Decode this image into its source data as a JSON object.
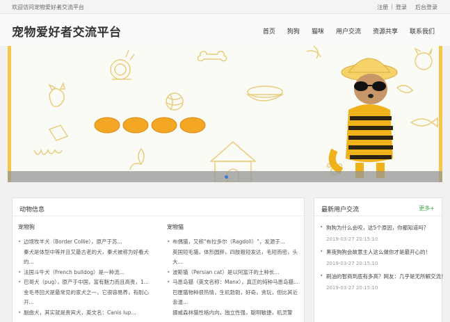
{
  "topbar": {
    "welcome": "欢迎访问宠物爱好者交流平台",
    "register": "注册",
    "separator": "|",
    "login": "登录",
    "admin_login": "后台登录"
  },
  "header": {
    "logo": "宠物爱好者交流平台",
    "nav": [
      "首页",
      "狗狗",
      "猫咪",
      "用户交流",
      "资源共享",
      "联系我们"
    ]
  },
  "banner": {
    "slide_count": 1,
    "active_slide": 1,
    "accent_color": "#f4c74a",
    "indicator_color": "#3a7bd5"
  },
  "animals": {
    "title": "动物信息",
    "dogs": {
      "title": "宠物狗",
      "items": [
        {
          "text": "边境牧羊犬（Border Collie），原产于苏...",
          "bullet": true
        },
        {
          "text": "秦犬是体型中等并且又最古老的犬，秦犬被称为好看犬的...",
          "bullet": false
        },
        {
          "text": "法国斗牛犬（French bulldog）是一种流...",
          "bullet": true
        },
        {
          "text": "巴哥犬（pug），原产于中国，富有魅力而且高贵，1...",
          "bullet": true
        },
        {
          "text": "金毛寻回犬是最常见的家犬之一，它很容易养，有耐心开...",
          "bullet": false
        },
        {
          "text": "副曲犬，其实就是贵宾犬，英文名：Canis lup...",
          "bullet": true
        }
      ]
    },
    "cats": {
      "title": "宠物猫",
      "items": [
        {
          "text": "布偶猫，又称\"布拉多尔（Ragdoll）\"，发源于...",
          "bullet": true
        },
        {
          "text": "英国短毛猫，体形圆胖，四肢粗短发达，毛短而密，头大...",
          "bullet": false
        },
        {
          "text": "波斯猫（Persian cat）是以阿富汗的土种长...",
          "bullet": true
        },
        {
          "text": "马恩岛猫（英文名称：Manx），真正的纯种马恩岛猫...",
          "bullet": true
        },
        {
          "text": "巴厘猫物种很热情，生机勃勃，好奇，贪玩，但比其近亲温...",
          "bullet": false
        },
        {
          "text": "挪威森林猫性格内向，独立性强，聪明敏捷，机灵警",
          "bullet": false
        }
      ]
    }
  },
  "recent": {
    "title": "最新用户交流",
    "more": "更多+",
    "posts": [
      {
        "title": "狗狗为什么会咬，这5个原因，你都知道吗？",
        "date": "2019-03-27 20:15:10"
      },
      {
        "title": "黑夜狗狗会故意主人这么做你才是最开心的！",
        "date": "2019-03-27 20:15:10"
      },
      {
        "title": "刷油的智商到底有多高？网友：几乎是无所解交流！",
        "date": "2019-03-27 20:15:10"
      }
    ]
  }
}
